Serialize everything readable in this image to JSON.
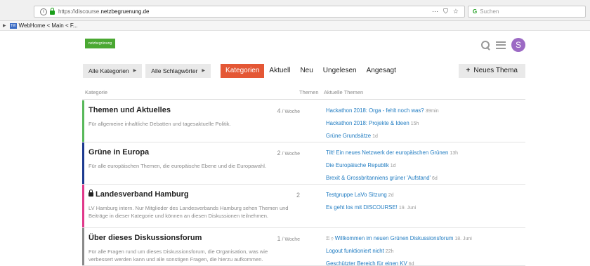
{
  "browser": {
    "info_icon": "info-icon",
    "url_prefix": "https://discourse.",
    "url_domain": "netzbegruenung.de",
    "actions": [
      "···",
      "⛉",
      "☆"
    ],
    "search_placeholder": "Suchen",
    "bookmark_label": "WebHome < Main < F..."
  },
  "site": {
    "logo_text": "netzbegrünung",
    "avatar_letter": "S",
    "brand_color": "#e45735"
  },
  "nav": {
    "all_categories": "Alle Kategorien",
    "all_tags": "Alle Schlagwörter",
    "tabs": [
      "Kategorien",
      "Aktuell",
      "Neu",
      "Ungelesen",
      "Angesagt"
    ],
    "new_topic": "Neues Thema"
  },
  "table": {
    "col_category": "Kategorie",
    "col_topics": "Themen",
    "col_latest": "Aktuelle Themen"
  },
  "categories": [
    {
      "name": "Themen und Aktuelles",
      "locked": false,
      "color": "#58b85a",
      "description": "Für allgemeine inhaltliche Debatten und tagesaktuelle Politik.",
      "count": "4",
      "per": " / Woche",
      "topics": [
        {
          "title": "Hackathon 2018: Orga - fehlt noch was?",
          "age": "39min"
        },
        {
          "title": "Hackathon 2018: Projekte & Ideen",
          "age": "15h"
        },
        {
          "title": "Grüne Grundsätze",
          "age": "1d"
        }
      ]
    },
    {
      "name": "Grüne in Europa",
      "locked": false,
      "color": "#1c3a8f",
      "description": "Für alle europäischen Themen, die europäische Ebene und die Europawahl.",
      "count": "2",
      "per": " / Woche",
      "topics": [
        {
          "title": "Tilt! Ein neues Netzwerk der europäischen Grünen",
          "age": "13h"
        },
        {
          "title": "Die Europäische Republik",
          "age": "1d"
        },
        {
          "title": "Brexit & Grossbritanniens grüner 'Aufstand'",
          "age": "6d"
        }
      ]
    },
    {
      "name": "Landesverband Hamburg",
      "locked": true,
      "color": "#e0388a",
      "description": "LV Hamburg intern. Nur Mitglieder des Landesverbands Hamburg sehen Themen und Beiträge in dieser Kategorie und können an diesen Diskussionen teilnehmen.",
      "count": "2",
      "per": "",
      "topics": [
        {
          "title": "Testgruppe LaVo Sitzung",
          "age": "2d"
        },
        {
          "title": "Es geht los mit DISCOURSE!",
          "age": "19. Juni"
        }
      ]
    },
    {
      "name": "Über dieses Diskussionsforum",
      "locked": false,
      "color": "#8a8a8a",
      "description": "Für alle Fragen rund um dieses Diskussionsforum, die Organisation, was wie verbessert werden kann und alle sonstigen Fragen, die hierzu aufkommen.",
      "count": "1",
      "per": " / Woche",
      "topics": [
        {
          "title": "Willkommen im neuen Grünen Diskussionsforum",
          "age": "18. Juni",
          "pinned": true
        },
        {
          "title": "Logout funktioniert nicht",
          "age": "22h"
        },
        {
          "title": "Geschützter Bereich für einen KV",
          "age": "6d"
        }
      ]
    }
  ]
}
